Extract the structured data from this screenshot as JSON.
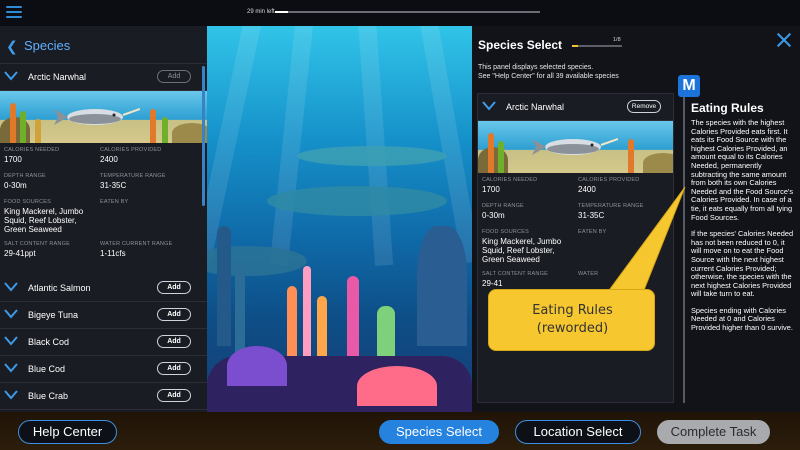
{
  "topbar": {
    "timer_label": "29 min left",
    "timer_progress": 0.05
  },
  "left_panel": {
    "title": "Species",
    "expanded": {
      "name": "Arctic Narwhal",
      "add_label": "Add",
      "stats": {
        "calories_needed_label": "CALORIES NEEDED",
        "calories_needed": "1700",
        "calories_provided_label": "CALORIES PROVIDED",
        "calories_provided": "2400",
        "depth_label": "DEPTH RANGE",
        "depth": "0-30m",
        "temperature_label": "TEMPERATURE RANGE",
        "temperature": "31-35C",
        "food_label": "FOOD SOURCES",
        "food": "King Mackerel, Jumbo Squid, Reef Lobster, Green Seaweed",
        "eaten_label": "EATEN BY",
        "eaten": "",
        "salt_label": "SALT CONTENT RANGE",
        "salt": "29-41ppt",
        "water_label": "WATER CURRENT RANGE",
        "water": "1-11cfs"
      }
    },
    "species": [
      {
        "name": "Atlantic Salmon",
        "add_label": "Add"
      },
      {
        "name": "Bigeye Tuna",
        "add_label": "Add"
      },
      {
        "name": "Black Cod",
        "add_label": "Add"
      },
      {
        "name": "Blue Cod",
        "add_label": "Add"
      },
      {
        "name": "Blue Crab",
        "add_label": "Add"
      }
    ]
  },
  "select_panel": {
    "title": "Species Select",
    "progress_count": "1/8",
    "progress": 0.125,
    "description_line1": "This panel displays selected species.",
    "description_line2": "See \"Help Center\" for all 39 available species",
    "card": {
      "name": "Arctic Narwhal",
      "remove_label": "Remove",
      "stats": {
        "calories_needed_label": "CALORIES NEEDED",
        "calories_needed": "1700",
        "calories_provided_label": "CALORIES PROVIDED",
        "calories_provided": "2400",
        "depth_label": "DEPTH RANGE",
        "depth": "0-30m",
        "temperature_label": "TEMPERATURE RANGE",
        "temperature": "31-35C",
        "food_label": "FOOD SOURCES",
        "food": "King Mackerel, Jumbo Squid, Reef Lobster, Green Seaweed",
        "eaten_label": "EATEN BY",
        "eaten": "",
        "salt_label": "SALT CONTENT RANGE",
        "salt": "29-41",
        "water_label": "WATER",
        "water": ""
      }
    }
  },
  "rules": {
    "logo_letter": "M",
    "title": "Eating Rules",
    "p1": "The species with the highest Calories Provided eats first. It eats its Food Source with the highest Calories Provided, an amount equal to its Calories Needed, permanently subtracting the same amount from both its own Calories Needed and the Food Source's Calories Provided. In case of a tie, it eats equally from all tying Food Sources.",
    "p2": "If the species' Calories Needed has not been reduced to 0, it will move on to eat the Food Source with the next highest current Calories Provided; otherwise, the species with the next highest Calories Provided will take turn to eat.",
    "p3": "Species ending with Calories Needed at 0 and Calories Provided higher than 0 survive."
  },
  "callout": {
    "line1": "Eating Rules",
    "line2": "(reworded)"
  },
  "bottom": {
    "help": "Help Center",
    "species_select": "Species Select",
    "location_select": "Location Select",
    "complete": "Complete Task"
  },
  "colors": {
    "accent": "#2583df",
    "callout": "#f6c72f",
    "timer_fill": "#ffffff",
    "progress_fill": "#f2c230"
  }
}
